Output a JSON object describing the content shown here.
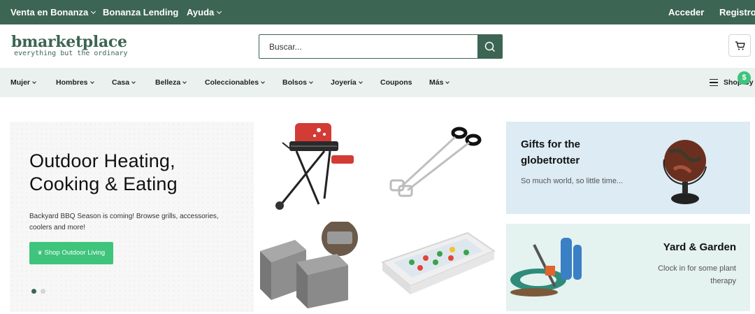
{
  "topbar": {
    "sell": "Venta en Bonanza",
    "lending": "Bonanza Lending",
    "help": "Ayuda",
    "login": "Acceder",
    "register": "Registro"
  },
  "header": {
    "logo_main": "bmarketplace",
    "logo_sub": "everything but the ordinary",
    "search_placeholder": "Buscar..."
  },
  "categories": [
    "Mujer",
    "Hombres",
    "Casa",
    "Belleza",
    "Coleccionables",
    "Bolsos",
    "Joyería",
    "Coupons",
    "Más"
  ],
  "shop_by": "Shop By",
  "hero": {
    "title": "Outdoor Heating, Cooking & Eating",
    "text": "Backyard BBQ Season is coming! Browse grills, accessories, coolers and more!",
    "button": "Shop Outdoor Living",
    "active_slide": 1,
    "slide_count": 2
  },
  "promos": {
    "globetrotter": {
      "title": "Gifts for the globetrotter",
      "subtitle": "So much world, so little time..."
    },
    "garden": {
      "title": "Yard & Garden",
      "subtitle": "Clock in for some plant therapy"
    }
  },
  "colors": {
    "brand": "#3d6553",
    "accent": "#3ec47b",
    "catbar": "#eaf1ef",
    "promo_blue": "#dcebf4",
    "promo_teal": "#e4f2f0"
  }
}
